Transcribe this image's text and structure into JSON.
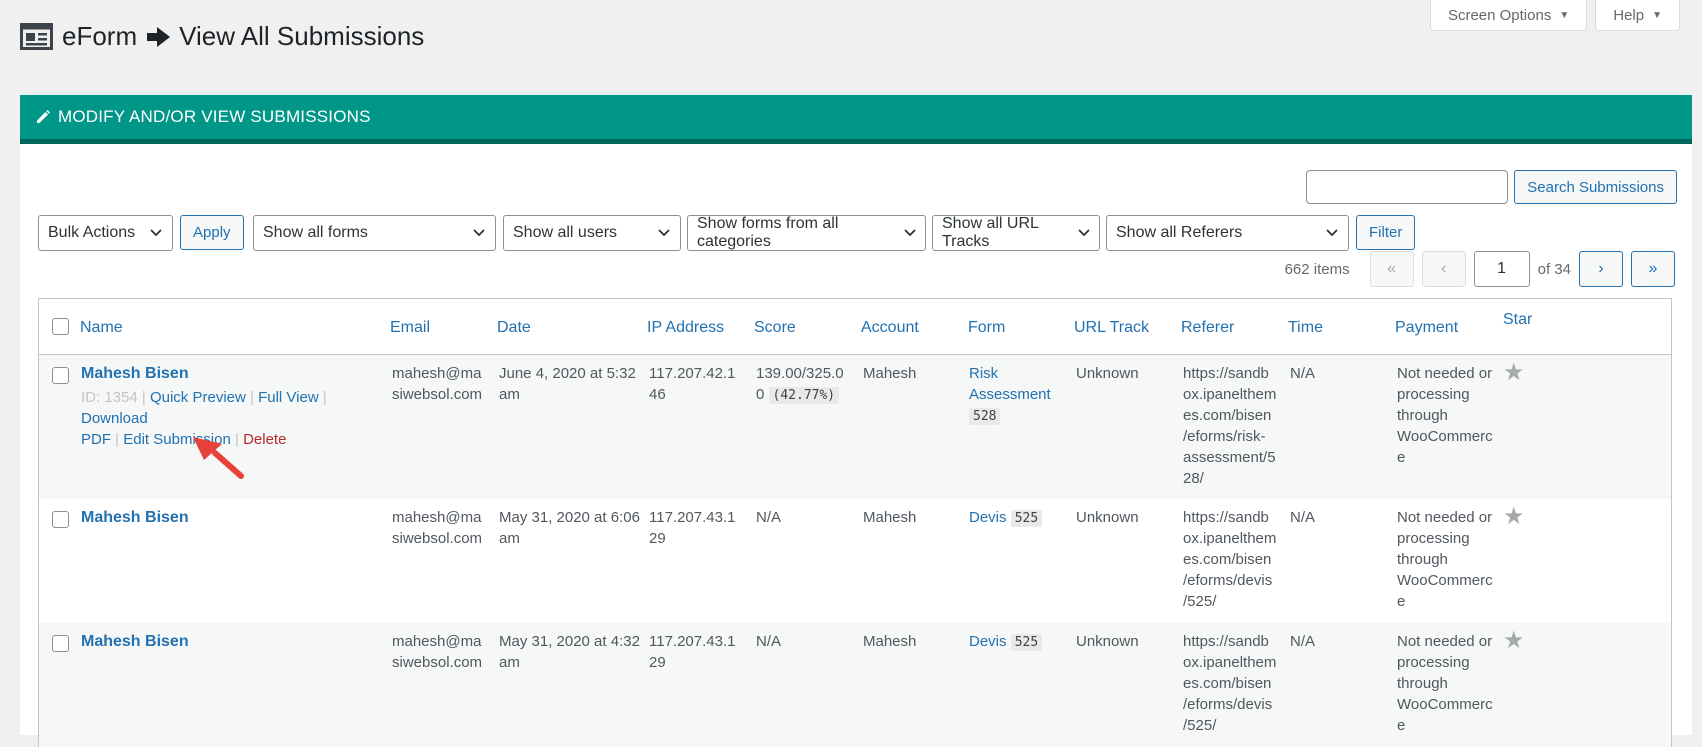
{
  "screen_tabs": {
    "options": "Screen Options",
    "help": "Help"
  },
  "title": {
    "app": "eForm",
    "page": "View All Submissions"
  },
  "panel_title": "MODIFY AND/OR VIEW SUBMISSIONS",
  "search": {
    "placeholder": "",
    "button": "Search Submissions"
  },
  "filters": {
    "bulk": "Bulk Actions",
    "apply": "Apply",
    "forms": "Show all forms",
    "users": "Show all users",
    "categories": "Show forms from all categories",
    "url_tracks": "Show all URL Tracks",
    "referers": "Show all Referers",
    "filter": "Filter"
  },
  "pager": {
    "count": "662 items",
    "first": "«",
    "prev": "‹",
    "current": "1",
    "of": "of 34",
    "next": "›",
    "last": "»"
  },
  "columns": {
    "name": "Name",
    "email": "Email",
    "date": "Date",
    "ip": "IP Address",
    "score": "Score",
    "account": "Account",
    "form": "Form",
    "url_track": "URL Track",
    "referer": "Referer",
    "time": "Time",
    "payment": "Payment",
    "star": "Star"
  },
  "row_actions": {
    "id": "ID: 1354",
    "quick_preview": "Quick Preview",
    "full_view": "Full View",
    "download": "Download",
    "pdf": "PDF",
    "edit": "Edit Submission",
    "delete": "Delete"
  },
  "rows": [
    {
      "name": "Mahesh Bisen",
      "email": [
        "mahesh@ma",
        "siwebsol.com"
      ],
      "date": [
        "June 4, 2020 at 5:32",
        "am"
      ],
      "ip": [
        "117.207.42.1",
        "46"
      ],
      "score": [
        "139.00/325.0",
        "0"
      ],
      "score_pct": "(42.77%)",
      "account": "Mahesh",
      "form": [
        "Risk",
        "Assessment"
      ],
      "form_id": "528",
      "url_track": "Unknown",
      "referer": [
        "https://sandb",
        "ox.ipanelthem",
        "es.com/bisen",
        "/eforms/risk-",
        "assessment/5",
        "28/"
      ],
      "time": "N/A",
      "payment": [
        "Not needed or",
        "processing",
        "through",
        "WooCommerc",
        "e"
      ]
    },
    {
      "name": "Mahesh Bisen",
      "email": [
        "mahesh@ma",
        "siwebsol.com"
      ],
      "date": [
        "May 31, 2020 at 6:06",
        "am"
      ],
      "ip": [
        "117.207.43.1",
        "29"
      ],
      "score": "N/A",
      "account": "Mahesh",
      "form": "Devis",
      "form_id": "525",
      "url_track": "Unknown",
      "referer": [
        "https://sandb",
        "ox.ipanelthem",
        "es.com/bisen",
        "/eforms/devis",
        "/525/"
      ],
      "time": "N/A",
      "payment": [
        "Not needed or",
        "processing",
        "through",
        "WooCommerc",
        "e"
      ]
    },
    {
      "name": "Mahesh Bisen",
      "email": [
        "mahesh@ma",
        "siwebsol.com"
      ],
      "date": [
        "May 31, 2020 at 4:32",
        "am"
      ],
      "ip": [
        "117.207.43.1",
        "29"
      ],
      "score": "N/A",
      "account": "Mahesh",
      "form": "Devis",
      "form_id": "525",
      "url_track": "Unknown",
      "referer": [
        "https://sandb",
        "ox.ipanelthem",
        "es.com/bisen",
        "/eforms/devis",
        "/525/"
      ],
      "time": "N/A",
      "payment": [
        "Not needed or",
        "processing",
        "through",
        "WooCommerc",
        "e"
      ]
    }
  ],
  "colors": {
    "header": "#009688",
    "link": "#2271b1",
    "delete": "#b32d2e",
    "arrow": "#e8403a"
  },
  "icons": {
    "form": "form-window-icon",
    "arrow": "right-arrow-icon",
    "pencil": "pencil-icon",
    "star": "star-icon",
    "pointer": "red-pointer-arrow-icon"
  }
}
